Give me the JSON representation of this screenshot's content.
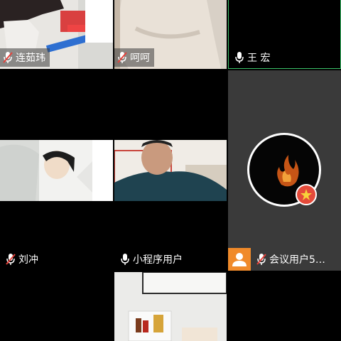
{
  "participants": [
    {
      "id": "p1",
      "name": "连茹玮",
      "mic_muted": true
    },
    {
      "id": "p2",
      "name": "呵呵",
      "mic_muted": true
    },
    {
      "id": "p3",
      "name": "王 宏",
      "mic_muted": false,
      "active_speaker": true
    },
    {
      "id": "p4",
      "name": "",
      "mic_muted": false
    },
    {
      "id": "p5",
      "name": "",
      "mic_muted": false
    },
    {
      "id": "p6",
      "name": "",
      "mic_muted": false
    },
    {
      "id": "p7",
      "name": "刘冲",
      "mic_muted": true
    },
    {
      "id": "p8",
      "name": "小程序用户",
      "mic_muted": false
    },
    {
      "id": "p9",
      "name": "会议用户5…",
      "mic_muted": true,
      "avatar_badge": true
    },
    {
      "id": "p10",
      "name": "",
      "mic_muted": false
    },
    {
      "id": "p11",
      "name": "",
      "mic_muted": false
    },
    {
      "id": "p12",
      "name": "",
      "mic_muted": false
    }
  ],
  "colors": {
    "background": "#000000",
    "active_border": "#3cc36a",
    "avatar_badge": "#f08a2a"
  }
}
